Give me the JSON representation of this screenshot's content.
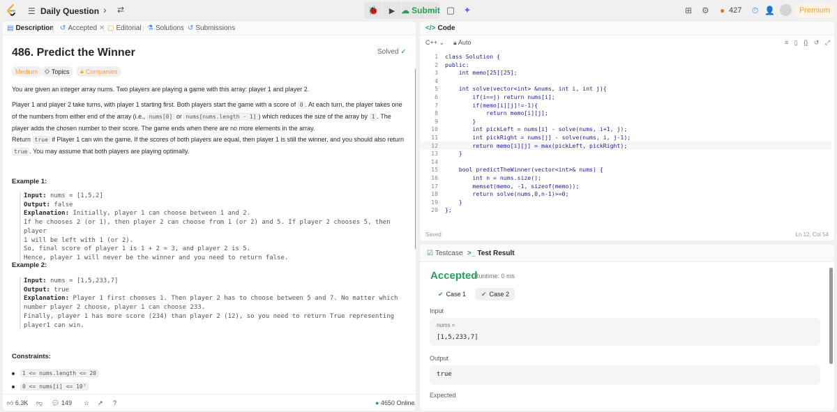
{
  "nav": {
    "title": "Daily Question",
    "submit_label": "Submit",
    "streak": "427",
    "premium": "Premium"
  },
  "tabs": {
    "description": "Description",
    "accepted": "Accepted",
    "editorial": "Editorial",
    "solutions": "Solutions",
    "submissions": "Submissions"
  },
  "problem": {
    "title": "486. Predict the Winner",
    "status": "Solved",
    "difficulty": "Medium",
    "topics": "Topics",
    "companies": "Companies",
    "p1": "You are given an integer array nums. Two players are playing a game with this array: player 1 and player 2.",
    "p2_a": "Player 1 and player 2 take turns, with player 1 starting first. Both players start the game with a score of ",
    "p2_b": "0",
    "p2_c": ". At each turn, the player takes one of the numbers from either end of the array (i.e., ",
    "p2_d": "nums[0]",
    "p2_e": " or ",
    "p2_f": "nums[nums.length - 1]",
    "p2_g": ") which reduces the size of the array by ",
    "p2_h": "1",
    "p2_i": ". The player adds the chosen number to their score. The game ends when there are no more elements in the array.",
    "p3_a": "Return ",
    "p3_b": "true",
    "p3_c": " if Player 1 can win the game. If the scores of both players are equal, then player 1 is still the winner, and you should also return ",
    "p3_d": "true",
    "p3_e": ". You may assume that both players are playing optimally.",
    "example1_title": "Example 1:",
    "example1": [
      {
        "k": "Input: ",
        "v": "nums = [1,5,2]"
      },
      {
        "k": "Output: ",
        "v": "false"
      },
      {
        "k": "Explanation: ",
        "v": "Initially, player 1 can choose between 1 and 2."
      },
      {
        "k": "",
        "v": "If he chooses 2 (or 1), then player 2 can choose from 1 (or 2) and 5. If player 2 chooses 5, then player"
      },
      {
        "k": "",
        "v": "1 will be left with 1 (or 2)."
      },
      {
        "k": "",
        "v": "So, final score of player 1 is 1 + 2 = 3, and player 2 is 5."
      },
      {
        "k": "",
        "v": "Hence, player 1 will never be the winner and you need to return false."
      }
    ],
    "example2_title": "Example 2:",
    "example2": [
      {
        "k": "Input: ",
        "v": "nums = [1,5,233,7]"
      },
      {
        "k": "Output: ",
        "v": "true"
      },
      {
        "k": "Explanation: ",
        "v": "Player 1 first chooses 1. Then player 2 has to choose between 5 and 7. No matter which"
      },
      {
        "k": "",
        "v": "number player 2 choose, player 1 can choose 233."
      },
      {
        "k": "",
        "v": "Finally, player 1 has more score (234) than player 2 (12), so you need to return True representing"
      },
      {
        "k": "",
        "v": "player1 can win."
      }
    ],
    "constraints_title": "Constraints:",
    "constraint1": "1 <= nums.length <= 20",
    "constraint2": "0 <= nums[i] <= 10⁷",
    "likes": "6.3K",
    "comments": "149",
    "online": "4650 Online"
  },
  "code": {
    "tab": "Code",
    "language": "C++",
    "auto": "Auto",
    "lines": [
      "class Solution {",
      "public:",
      "    int memo[25][25];",
      "",
      "    int solve(vector<int> &nums, int i, int j){",
      "        if(i==j) return nums[i];",
      "        if(memo[i][j]!=-1){",
      "            return memo[i][j];",
      "        }",
      "        int pickLeft = nums[i] - solve(nums, i+1, j);",
      "        int pickRight = nums[j] - solve(nums, i, j-1);",
      "        return memo[i][j] = max(pickLeft, pickRight);",
      "    }",
      "",
      "    bool predictTheWinner(vector<int>& nums) {",
      "        int n = nums.size();",
      "        memset(memo, -1, sizeof(memo));",
      "        return solve(nums,0,n-1)>=0;",
      "    }",
      "};"
    ],
    "line_numbers": [
      "1",
      "2",
      "3",
      "4",
      "5",
      "6",
      "7",
      "8",
      "9",
      "10",
      "11",
      "12",
      "13",
      "14",
      "15",
      "16",
      "17",
      "18",
      "19",
      "20"
    ],
    "saved": "Saved",
    "cursor": "Ln 12, Col 54"
  },
  "result": {
    "testcase_tab": "Testcase",
    "result_tab": "Test Result",
    "status": "Accepted",
    "runtime": "Runtime: 0 ms",
    "case1": "Case 1",
    "case2": "Case 2",
    "input_label": "Input",
    "input_var": "nums =",
    "input_val": "[1,5,233,7]",
    "output_label": "Output",
    "output_val": "true",
    "expected_label": "Expected"
  }
}
